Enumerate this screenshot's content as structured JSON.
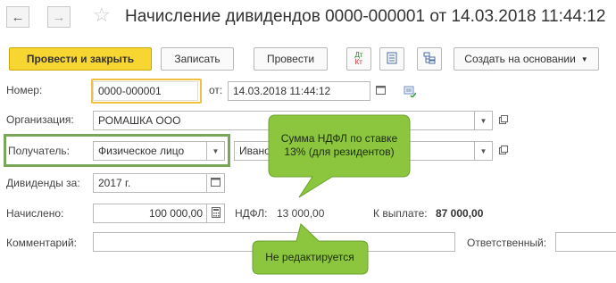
{
  "window": {
    "title": "Начисление дивидендов 0000-000001 от 14.03.2018 11:44:12"
  },
  "toolbar": {
    "post_close": "Провести и закрыть",
    "save": "Записать",
    "post": "Провести",
    "dt_kt_top": "Дт",
    "dt_kt_bottom": "Кт",
    "create_based": "Создать на основании"
  },
  "form": {
    "number_label": "Номер:",
    "number_value": "0000-000001",
    "date_label": "от:",
    "date_value": "14.03.2018 11:44:12",
    "org_label": "Организация:",
    "org_value": "РОМАШКА ООО",
    "recipient_label": "Получатель:",
    "recipient_type": "Физическое лицо",
    "recipient_name": "Иванов",
    "dividends_label": "Дивиденды за:",
    "dividends_value": "2017 г.",
    "accrued_label": "Начислено:",
    "accrued_value": "100 000,00",
    "ndfl_label": "НДФЛ:",
    "ndfl_value": "13 000,00",
    "payout_label": "К выплате:",
    "payout_value": "87 000,00",
    "comment_label": "Комментарий:",
    "comment_value": "",
    "responsible_label": "Ответственный:",
    "responsible_value": ""
  },
  "callouts": {
    "ndfl_rate": "Сумма НДФЛ по ставке 13% (для резидентов)",
    "not_editable": "Не редактируется"
  },
  "colors": {
    "accent_yellow": "#f7d631",
    "callout_green": "#8cc63e",
    "highlight_border": "#7aa65a",
    "focus_border": "#f0c040"
  }
}
